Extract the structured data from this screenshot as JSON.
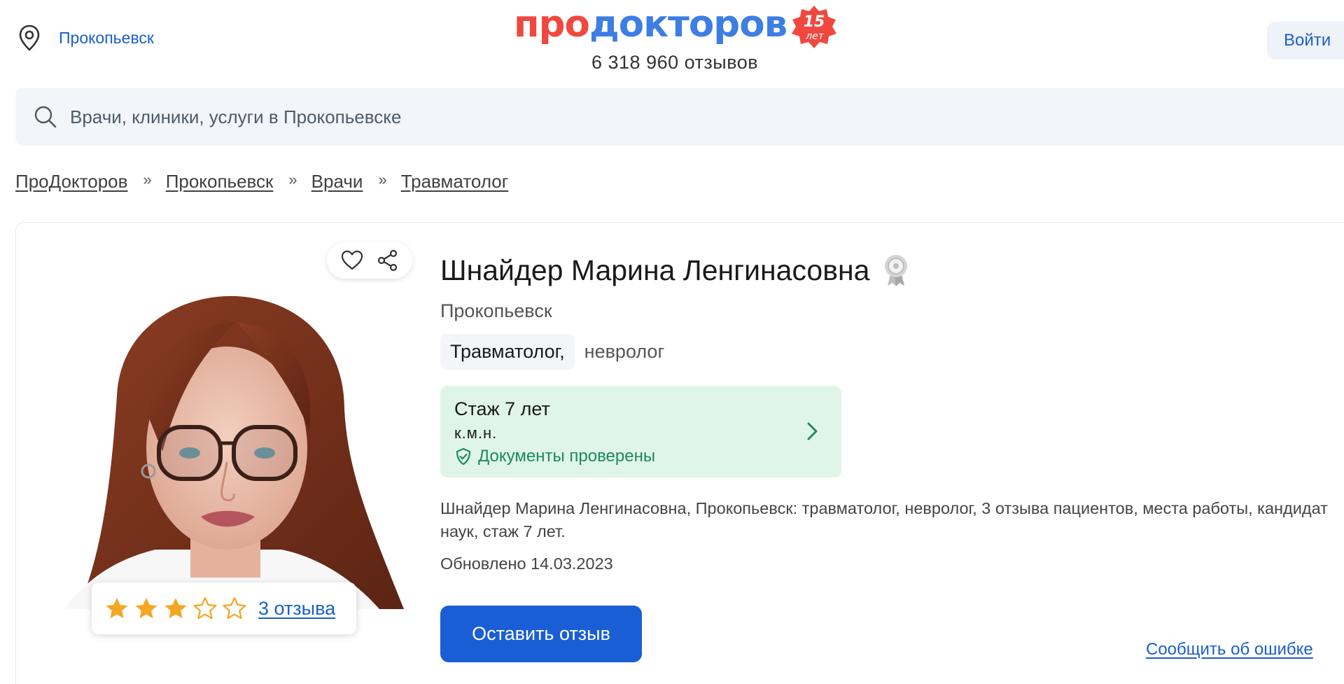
{
  "header": {
    "city": "Прокопьевск",
    "logo": {
      "part1": "про",
      "part2": "докторов",
      "badge_number": "15",
      "badge_word": "лет"
    },
    "reviews_total": "6 318 960 отзывов",
    "login_label": "Войти"
  },
  "search": {
    "placeholder": "Врачи, клиники, услуги в Прокопьевске"
  },
  "breadcrumbs": {
    "separator": "»",
    "items": [
      {
        "label": "ПроДокторов"
      },
      {
        "label": "Прокопьевск"
      },
      {
        "label": "Врачи"
      },
      {
        "label": "Травматолог"
      }
    ]
  },
  "doctor": {
    "name": "Шнайдер Марина Ленгинасовна",
    "city": "Прокопьевск",
    "specialty_main": "Травматолог,",
    "specialty_second": "невролог",
    "experience": "Стаж 7 лет",
    "degree": "к.м.н.",
    "verified": "Документы проверены",
    "description": "Шнайдер Марина Ленгинасовна, Прокопьевск: травматолог, невролог, 3 отзыва пациентов, места работы, кандидат наук, стаж 7 лет.",
    "updated": "Обновлено 14.03.2023",
    "rating": {
      "stars": 3,
      "max": 5,
      "reviews_link": "3 отзыва"
    }
  },
  "buttons": {
    "leave_review": "Оставить отзыв",
    "report_error": "Сообщить об ошибке"
  },
  "colors": {
    "accent": "#1a5ed6",
    "link": "#1a5fc9",
    "logo_red": "#f0483e",
    "logo_blue": "#3d7ee4",
    "verified_green": "#1d8a5a",
    "star": "#f5a623"
  },
  "icons": {
    "location": "map-pin-icon",
    "search": "search-icon",
    "favorite": "heart-icon",
    "share": "share-icon",
    "medal": "medal-icon",
    "verified": "shield-check-icon",
    "chevron": "chevron-right-icon"
  }
}
